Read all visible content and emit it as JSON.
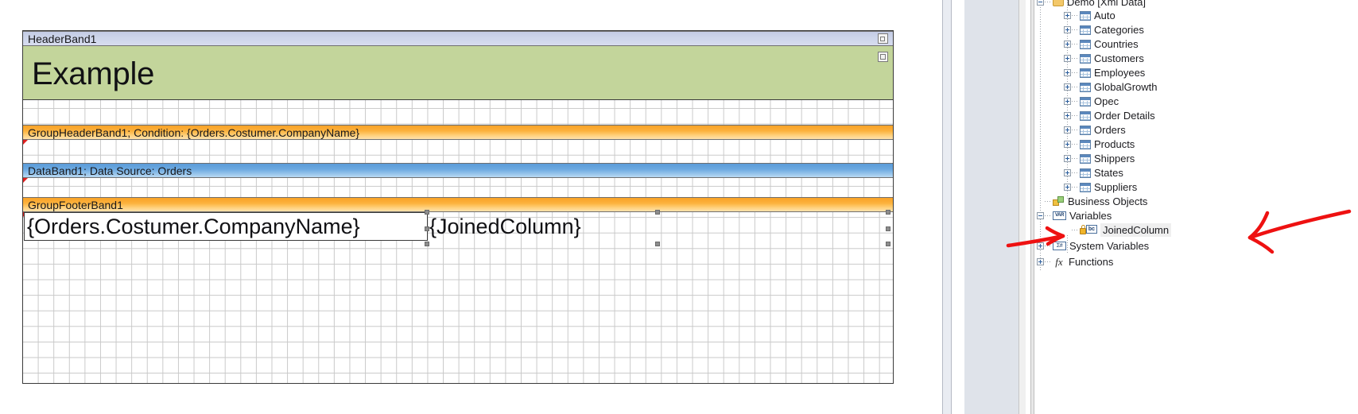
{
  "report_designer": {
    "bands": [
      {
        "id": "header",
        "caption": "HeaderBand1"
      },
      {
        "id": "group_header",
        "caption": "GroupHeaderBand1;  Condition:  {Orders.Costumer.CompanyName}"
      },
      {
        "id": "data",
        "caption": "DataBand1; Data Source: Orders"
      },
      {
        "id": "group_footer",
        "caption": "GroupFooterBand1"
      }
    ],
    "components": [
      {
        "id": "title",
        "text": "Example"
      },
      {
        "id": "company_name",
        "text": "{Orders.Costumer.CompanyName}"
      },
      {
        "id": "joined_column",
        "text": "{JoinedColumn}",
        "selected": true
      }
    ],
    "colors": {
      "header_band": "#cdd5ea",
      "group_band": "#fcb23d",
      "data_band": "#6ba8e0",
      "title_fill": "#c3d59b",
      "annotation": "#ee1111"
    }
  },
  "dictionary": {
    "tree": [
      {
        "label": "Demo [Xml Data]",
        "icon": "folder-icon",
        "indent": 0,
        "expander": "minus",
        "selected": false
      },
      {
        "label": "Auto",
        "icon": "table-icon",
        "indent": 1,
        "expander": "plus",
        "selected": false
      },
      {
        "label": "Categories",
        "icon": "table-icon",
        "indent": 1,
        "expander": "plus",
        "selected": false
      },
      {
        "label": "Countries",
        "icon": "table-icon",
        "indent": 1,
        "expander": "plus",
        "selected": false
      },
      {
        "label": "Customers",
        "icon": "table-icon",
        "indent": 1,
        "expander": "plus",
        "selected": false
      },
      {
        "label": "Employees",
        "icon": "table-icon",
        "indent": 1,
        "expander": "plus",
        "selected": false
      },
      {
        "label": "GlobalGrowth",
        "icon": "table-icon",
        "indent": 1,
        "expander": "plus",
        "selected": false
      },
      {
        "label": "Opec",
        "icon": "table-icon",
        "indent": 1,
        "expander": "plus",
        "selected": false
      },
      {
        "label": "Order Details",
        "icon": "table-icon",
        "indent": 1,
        "expander": "plus",
        "selected": false
      },
      {
        "label": "Orders",
        "icon": "table-icon",
        "indent": 1,
        "expander": "plus",
        "selected": false
      },
      {
        "label": "Products",
        "icon": "table-icon",
        "indent": 1,
        "expander": "plus",
        "selected": false
      },
      {
        "label": "Shippers",
        "icon": "table-icon",
        "indent": 1,
        "expander": "plus",
        "selected": false
      },
      {
        "label": "States",
        "icon": "table-icon",
        "indent": 1,
        "expander": "plus",
        "selected": false
      },
      {
        "label": "Suppliers",
        "icon": "table-icon",
        "indent": 1,
        "expander": "plus",
        "selected": false
      },
      {
        "label": "Business Objects",
        "icon": "business-objects-icon",
        "indent": 0,
        "expander": "none",
        "selected": false
      },
      {
        "label": "Variables",
        "icon": "variables-icon",
        "indent": 0,
        "expander": "minus",
        "selected": false
      },
      {
        "label": "JoinedColumn",
        "icon": "locked-variable-icon",
        "indent": 1,
        "expander": "none",
        "selected": true
      },
      {
        "label": "System Variables",
        "icon": "system-variables-icon",
        "indent": 0,
        "expander": "plus",
        "selected": false
      },
      {
        "label": "Functions",
        "icon": "functions-icon",
        "indent": 0,
        "expander": "plus",
        "selected": false
      }
    ],
    "icon_glyphs": {
      "variables": "VAR",
      "system_variables": "Σ#",
      "functions": "fx",
      "bc_badge": "bc"
    }
  }
}
